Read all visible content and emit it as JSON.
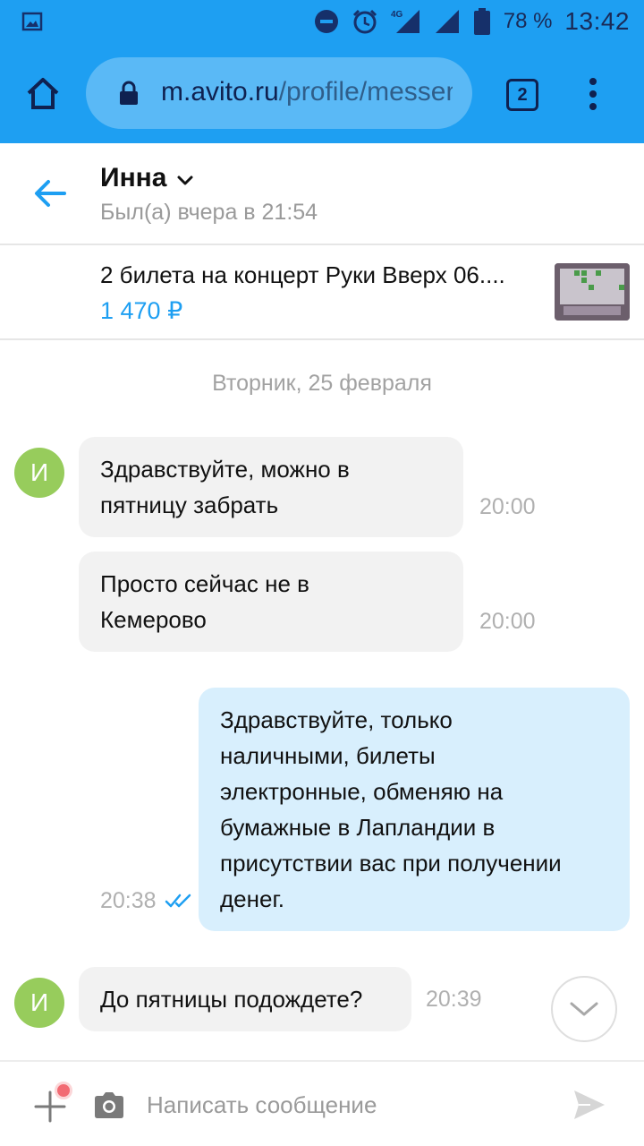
{
  "status_bar": {
    "battery_percent": "78 %",
    "time": "13:42",
    "network": "4G",
    "icons": [
      "gallery-icon",
      "do-not-disturb-icon",
      "alarm-icon",
      "signal-icon",
      "battery-icon"
    ]
  },
  "browser": {
    "url_host": "m.avito.ru",
    "url_path": "/profile/messenger",
    "tab_count": "2"
  },
  "chat_header": {
    "name": "Инна",
    "last_seen": "Был(а) вчера в 21:54"
  },
  "listing": {
    "title": "2 билета на концерт Руки Вверх 06....",
    "price": "1 470 ₽"
  },
  "chat": {
    "date_separator": "Вторник, 25 февраля",
    "avatar_letter": "И",
    "messages": [
      {
        "direction": "in",
        "text_lines": [
          "Здравствуйте, можно в",
          "пятницу забрать"
        ],
        "time": "20:00"
      },
      {
        "direction": "in",
        "text_lines": [
          "Просто сейчас не в",
          "Кемерово"
        ],
        "time": "20:00"
      },
      {
        "direction": "out",
        "text_lines": [
          "Здравствуйте, только",
          "наличными, билеты",
          "электронные, обменяю на",
          "бумажные в Лапландии в",
          "присутствии вас при получении",
          "денег."
        ],
        "time": "20:38",
        "status": "read"
      },
      {
        "direction": "in",
        "text_lines": [
          "До пятницы подождете?"
        ],
        "time": "20:39"
      }
    ]
  },
  "composer": {
    "placeholder": "Написать сообщение"
  },
  "colors": {
    "accent": "#1e9ff2",
    "incoming_bubble": "#f2f2f2",
    "outgoing_bubble": "#d8effd",
    "avatar": "#97cc5c"
  }
}
